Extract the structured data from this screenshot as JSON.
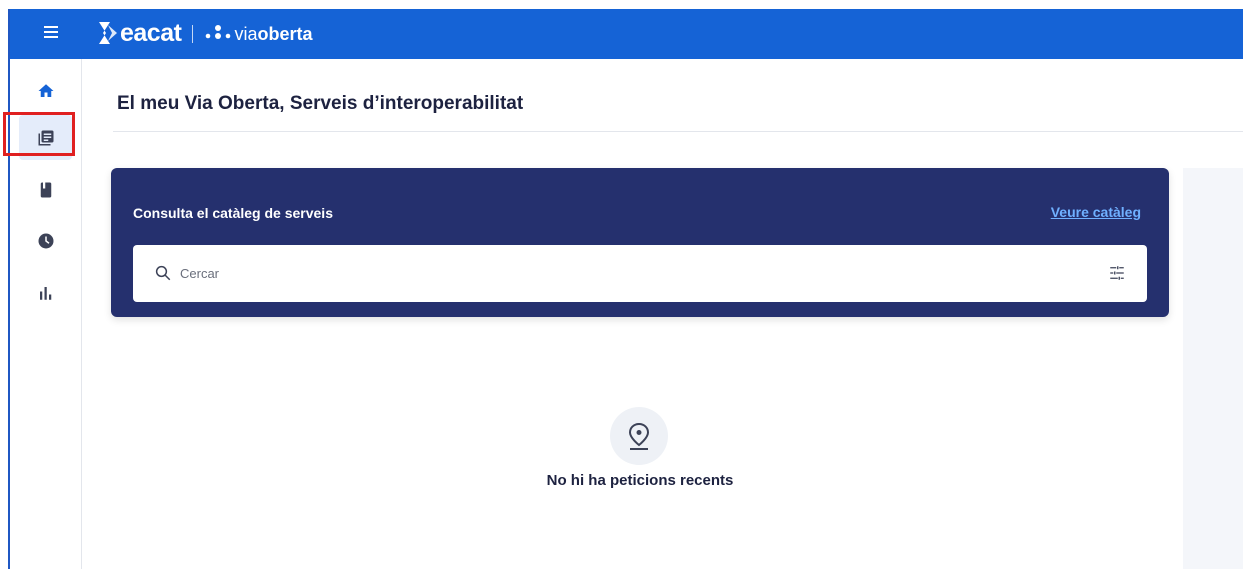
{
  "header": {
    "brand": "eacat",
    "product_prefix": "via",
    "product_suffix": "oberta"
  },
  "sidebar": {
    "items": [
      {
        "name": "home",
        "icon": "home-icon",
        "active": false
      },
      {
        "name": "services",
        "icon": "document-list-icon",
        "active": true
      },
      {
        "name": "catalog",
        "icon": "book-icon",
        "active": false
      },
      {
        "name": "history",
        "icon": "clock-icon",
        "active": false
      },
      {
        "name": "statistics",
        "icon": "bar-chart-icon",
        "active": false
      }
    ]
  },
  "main": {
    "title": "El meu Via Oberta, Serveis d’interoperabilitat",
    "catalog_card": {
      "title": "Consulta el catàleg de serveis",
      "link_label": "Veure catàleg",
      "search": {
        "placeholder": "Cercar",
        "value": ""
      }
    },
    "empty_state": {
      "icon": "location-pin-icon",
      "message": "No hi ha peticions recents"
    }
  },
  "colors": {
    "topbar": "#1563d6",
    "card_background": "#25306e",
    "link": "#6fb0ff",
    "highlight": "#e02020"
  }
}
